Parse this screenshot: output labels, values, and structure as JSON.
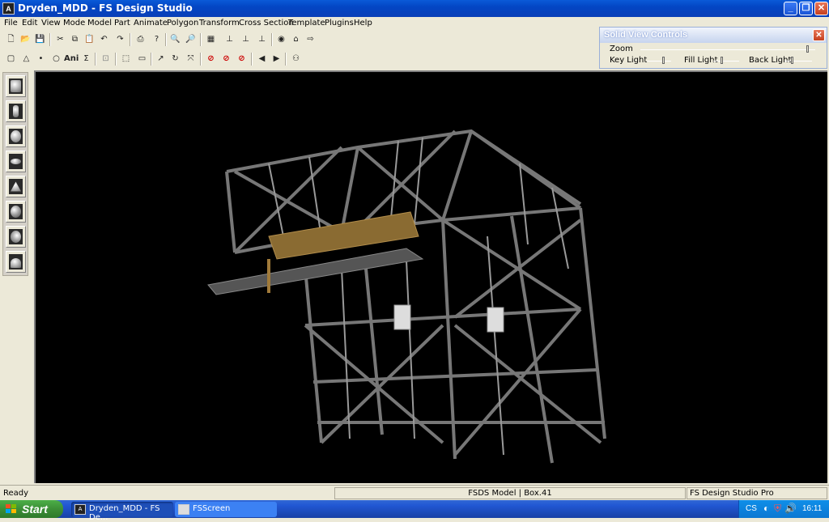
{
  "window": {
    "title": "Dryden_MDD - FS Design Studio",
    "app_icon": "fsds-app-icon"
  },
  "menu": [
    "File",
    "Edit",
    "View",
    "Mode",
    "Model",
    "Part",
    "Animate",
    "Polygon",
    "Transform",
    "Cross Section",
    "Template",
    "Plugins",
    "Help"
  ],
  "toolbar": {
    "ani_label": "Ani",
    "sigma_label": "Σ"
  },
  "solid_view": {
    "title": "Solid View Controls",
    "zoom_label": "Zoom",
    "key_light_label": "Key Light",
    "fill_light_label": "Fill Light",
    "back_light_label": "Back Light",
    "zoom_level": 0.96,
    "key_light_level": 0.7,
    "fill_light_level": 0.35,
    "back_light_level": 0.3
  },
  "shapes": [
    "box-icon",
    "cylinder-icon",
    "sphere-icon",
    "ellipsoid-icon",
    "cone-icon",
    "geosphere-icon",
    "geosphere-alt-icon",
    "hemisphere-icon"
  ],
  "status": {
    "ready": "Ready",
    "model": "FSDS Model | Box.41",
    "product": "FS Design Studio Pro"
  },
  "taskbar": {
    "start": "Start",
    "task1": "Dryden_MDD - FS De...",
    "task2": "FSScreen",
    "tray_lang": "CS",
    "clock": "16:11"
  }
}
